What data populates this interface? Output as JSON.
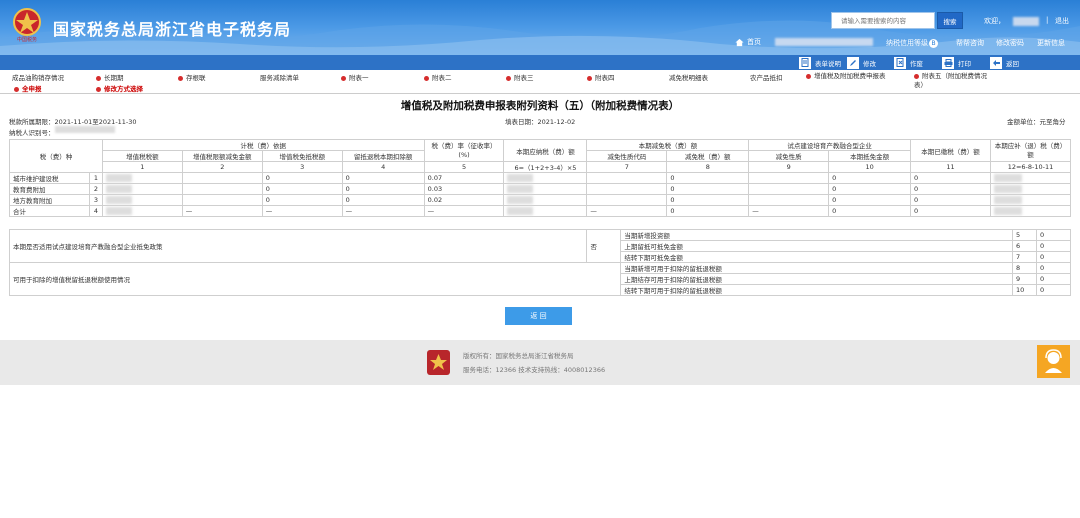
{
  "header": {
    "site_title": "国家税务总局浙江省电子税务局",
    "logo_text": "中国税务",
    "search_placeholder": "请输入需要搜索的内容",
    "search_button": "搜索",
    "welcome": "欢迎，",
    "separator": "|",
    "logout": "退出",
    "home": "首页",
    "credit_status": "纳税信用等级",
    "credit_badge": "B",
    "help": "帮帮咨询",
    "change_password": "修改密码",
    "update_info": "更新信息"
  },
  "toolbar": {
    "items": [
      "表单说明",
      "修改",
      "作废",
      "打印",
      "返回"
    ]
  },
  "form_tabs": {
    "row1": [
      "成品油购销存情况",
      "长期期",
      "存根联",
      "服务减除清单",
      "附表一",
      "附表二",
      "附表三",
      "附表四",
      "减免税明细表",
      "农产品抵扣",
      "增值税及附加税费申报表",
      "附表五（附加税费情况表）"
    ],
    "row2": [
      "全申报",
      "修改方式选择"
    ]
  },
  "document": {
    "title": "增值税及附加税费申报表附列资料（五）（附加税费情况表）",
    "period": "税款所属期限：2021-11-01至2021-11-30",
    "fill_date": "填表日期：2021-12-02",
    "unit": "金额单位：元至角分",
    "taxpayer_id_label": "纳税人识别号："
  },
  "table": {
    "h_tax_type": "税（费）种",
    "h_basis": "计税（费）依据",
    "h_rate": "税（费）率（征收率）(%)",
    "h_due": "本期应纳税（费）额",
    "h_relief": "本期减免税（费）额",
    "h_pilot": "试点建设培育产教融合型企业",
    "h_paid": "本期已缴税（费）额",
    "h_refund": "本期应补（退）税（费）额",
    "sub": [
      "增值税税额",
      "增值税限额减免金额",
      "增值税免抵税额",
      "留抵退税本期扣除额",
      "减免性质代码",
      "减免税（费）额",
      "减免性质",
      "本期抵免金额"
    ],
    "nums": [
      "1",
      "2",
      "3",
      "4",
      "5",
      "6=（1+2+3-4）×5",
      "7",
      "8",
      "9",
      "10",
      "11",
      "12=6-8-10-11"
    ],
    "rows": [
      {
        "name": "城市维护建设税",
        "no": "1",
        "c2": "0",
        "c4": "0",
        "rate": "0.07",
        "c8": "0",
        "c10": "0",
        "c11": "0"
      },
      {
        "name": "教育费附加",
        "no": "2",
        "c2": "0",
        "c4": "0",
        "rate": "0.03",
        "c8": "0",
        "c10": "0",
        "c11": "0"
      },
      {
        "name": "地方教育附加",
        "no": "3",
        "c2": "0",
        "c4": "0",
        "rate": "0.02",
        "c8": "0",
        "c10": "0",
        "c11": "0"
      }
    ],
    "total": {
      "name": "合计",
      "no": "4",
      "dash": "—",
      "c8": "0",
      "c10": "0",
      "c11": "0"
    }
  },
  "info": {
    "q1": "本期是否适用试点建设培育产教融合型企业抵免政策",
    "q1_answer": "否",
    "q1_items": [
      {
        "label": "当期新增投资额",
        "no": "5",
        "val": "0"
      },
      {
        "label": "上期留抵可抵免金额",
        "no": "6",
        "val": "0"
      },
      {
        "label": "结转下期可抵免金额",
        "no": "7",
        "val": "0"
      }
    ],
    "q2": "可用于扣除的增值税留抵退税额使用情况",
    "q2_items": [
      {
        "label": "当期新增可用于扣除的留抵退税额",
        "no": "8",
        "val": "0"
      },
      {
        "label": "上期结存可用于扣除的留抵退税额",
        "no": "9",
        "val": "0"
      },
      {
        "label": "结转下期可用于扣除的留抵退税额",
        "no": "10",
        "val": "0"
      }
    ]
  },
  "return_button": "返 回",
  "footer": {
    "copyright": "版权所有：国家税务总局浙江省税务局",
    "hotline": "服务电话：12366 技术支持热线：4008012366"
  },
  "colors": {
    "header": "#2a7fd6",
    "toolbar": "#2d72c6",
    "return_button": "#3d9be8",
    "tab_dot": "#d62d2d",
    "service_icon": "#f5a623"
  }
}
